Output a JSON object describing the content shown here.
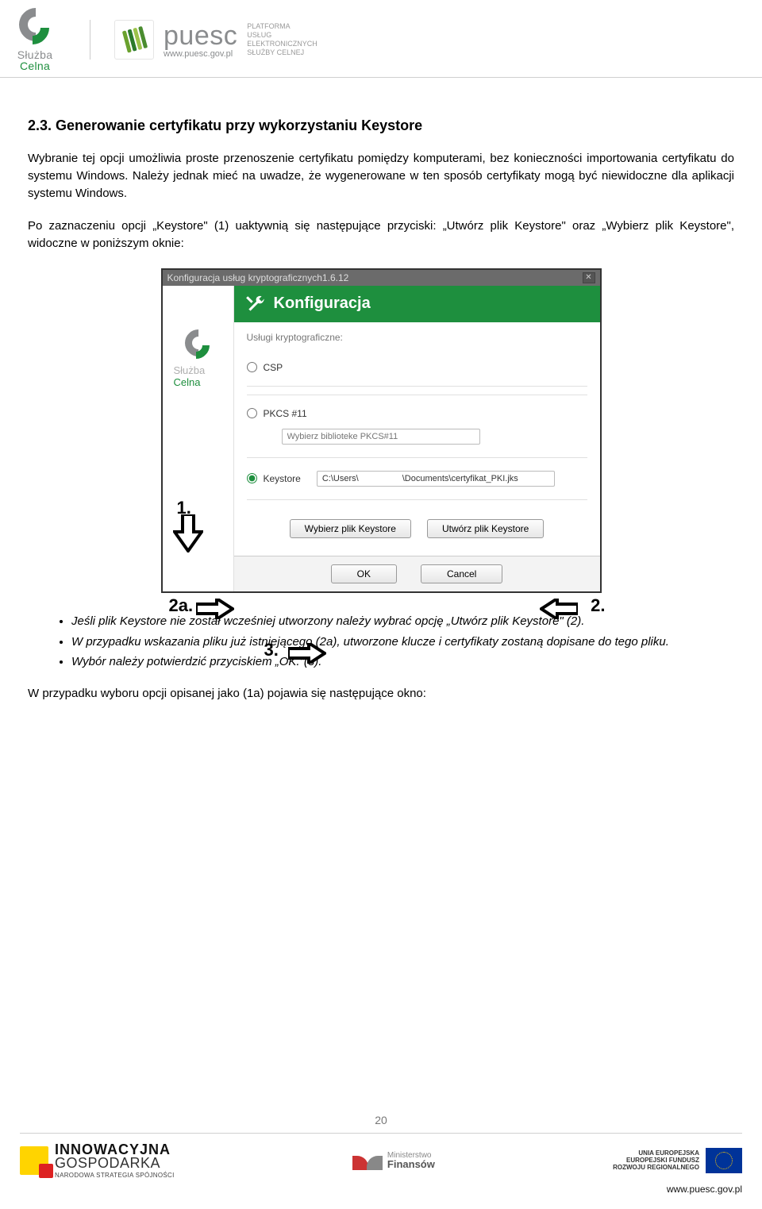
{
  "header": {
    "sc_line1": "Służba",
    "sc_line2": "Celna",
    "puesc_name": "puesc",
    "puesc_url": "www.puesc.gov.pl",
    "puesc_desc": "PLATFORMA\nUSŁUG\nELEKTRONICZNYCH\nSŁUŻBY CELNEJ"
  },
  "section": {
    "heading": "2.3. Generowanie certyfikatu przy wykorzystaniu Keystore",
    "p1": "Wybranie tej opcji umożliwia proste przenoszenie certyfikatu pomiędzy komputerami, bez konieczności importowania certyfikatu do systemu Windows. Należy jednak mieć na uwadze, że wygenerowane w ten sposób certyfikaty mogą być niewidoczne dla aplikacji systemu Windows.",
    "p2": "Po zaznaczeniu opcji „Keystore\" (1) uaktywnią się następujące przyciski: „Utwórz plik Keystore\" oraz „Wybierz plik Keystore\", widoczne w poniższym oknie:"
  },
  "dialog": {
    "title": "Konfiguracja usług kryptograficznych1.6.12",
    "header": "Konfiguracja",
    "label": "Usługi kryptograficzne:",
    "opt_csp": "CSP",
    "opt_pkcs": "PKCS #11",
    "pkcs_placeholder": "Wybierz biblioteke PKCS#11",
    "opt_keystore": "Keystore",
    "keystore_path": "C:\\Users\\                  \\Documents\\certyfikat_PKI.jks",
    "btn_select": "Wybierz plik Keystore",
    "btn_create": "Utwórz plik Keystore",
    "btn_ok": "OK",
    "btn_cancel": "Cancel",
    "sidebar_line1": "Służba",
    "sidebar_line2": "Celna",
    "marker_1": "1.",
    "marker_2a": "2a.",
    "marker_2": "2.",
    "marker_3": "3."
  },
  "bullets": {
    "b1": "Jeśli plik Keystore nie został wcześniej utworzony należy wybrać opcję „Utwórz plik Keystore\" (2).",
    "b2": "W przypadku wskazania pliku już istniejącego (2a), utworzone klucze i certyfikaty zostaną dopisane do tego pliku.",
    "b3": "Wybór należy potwierdzić przyciskiem „OK.\"(3)."
  },
  "after": "W przypadku wyboru opcji opisanej jako (1a) pojawia się następujące okno:",
  "footer": {
    "page": "20",
    "ig_line1": "INNOWACYJNA",
    "ig_line2": "GOSPODARKA",
    "ig_line3": "NARODOWA STRATEGIA SPÓJNOŚCI",
    "mf_line1": "Ministerstwo",
    "mf_line2": "Finansów",
    "ue_line1": "UNIA EUROPEJSKA",
    "ue_line2": "EUROPEJSKI FUNDUSZ",
    "ue_line3": "ROZWOJU REGIONALNEGO",
    "url": "www.puesc.gov.pl"
  }
}
